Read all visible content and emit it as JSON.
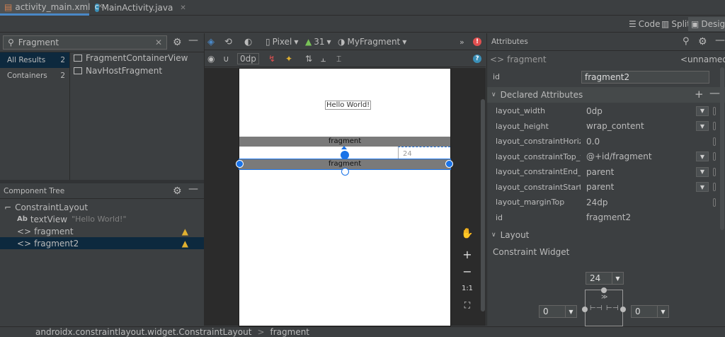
{
  "tabs": [
    {
      "label": "activity_main.xml",
      "active": true
    },
    {
      "label": "MainActivity.java",
      "active": false
    }
  ],
  "view_modes": {
    "code": "Code",
    "split": "Split",
    "design": "Design"
  },
  "palette": {
    "search_value": "Fragment",
    "categories": [
      {
        "label": "All Results",
        "count": "2"
      },
      {
        "label": "Containers",
        "count": "2"
      }
    ],
    "items": [
      "FragmentContainerView",
      "NavHostFragment"
    ]
  },
  "component_tree": {
    "title": "Component Tree",
    "items": [
      {
        "label": "ConstraintLayout",
        "sub": ""
      },
      {
        "label": "textView",
        "sub": "\"Hello World!\""
      },
      {
        "label": "fragment",
        "sub": ""
      },
      {
        "label": "fragment2",
        "sub": ""
      }
    ]
  },
  "design_toolbar": {
    "device": "Pixel",
    "api": "31",
    "theme": "MyFragment",
    "margin": "0dp"
  },
  "canvas": {
    "hello_text": "Hello World!",
    "fragment1_label": "fragment",
    "fragment2_label": "fragment",
    "margin_label": "24"
  },
  "zoom_controls": {
    "plus": "+",
    "minus": "−",
    "one_to_one": "1:1"
  },
  "attributes": {
    "title": "Attributes",
    "component_tag": "fragment",
    "component_name": "<unnamed>",
    "id_label": "id",
    "id_value": "fragment2",
    "declared_title": "Declared Attributes",
    "declared": [
      {
        "name": "layout_width",
        "value": "0dp"
      },
      {
        "name": "layout_height",
        "value": "wrap_content"
      },
      {
        "name": "layout_constraintHorizo...",
        "value": "0.0"
      },
      {
        "name": "layout_constraintTop_to...",
        "value": "@+id/fragment"
      },
      {
        "name": "layout_constraintEnd_toE...",
        "value": "parent"
      },
      {
        "name": "layout_constraintStart_to...",
        "value": "parent"
      },
      {
        "name": "layout_marginTop",
        "value": "24dp"
      },
      {
        "name": "id",
        "value": "fragment2"
      }
    ],
    "layout_title": "Layout",
    "constraint_widget": "Constraint Widget",
    "margin_top": "24",
    "margin_left": "0",
    "margin_right": "0"
  },
  "status_bar": {
    "path1": "androidx.constraintlayout.widget.ConstraintLayout",
    "sep": ">",
    "path2": "fragment"
  },
  "colors": {
    "accent": "#4a88c7",
    "selected_bg": "#0d293e",
    "warning": "#e0b030",
    "error": "#e05050"
  }
}
